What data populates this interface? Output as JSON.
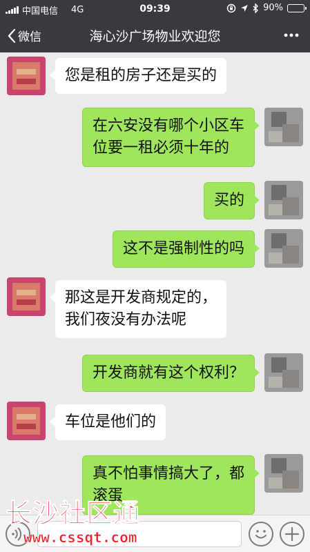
{
  "status_bar": {
    "carrier": "中国电信",
    "network": "4G",
    "time": "09:39",
    "battery_text": "90%",
    "battery_level": 0.9
  },
  "nav": {
    "back_label": "微信",
    "title": "海心沙广场物业欢迎您",
    "more_icon": "more-dots-icon"
  },
  "colors": {
    "bar": "#393a3f",
    "chat_bg": "#ebebeb",
    "bubble_out": "#9fe65c",
    "bubble_in": "#ffffff",
    "watermark": "#f41d2c"
  },
  "messages": [
    {
      "side": "in",
      "lines": [
        "您是租的房子还是买的"
      ]
    },
    {
      "side": "out",
      "lines": [
        "在六安没有哪个小区车",
        "位要一租必须十年的"
      ]
    },
    {
      "side": "out",
      "lines": [
        "买的"
      ]
    },
    {
      "side": "out",
      "lines": [
        "这不是强制性的吗"
      ]
    },
    {
      "side": "in",
      "lines": [
        "那这是开发商规定的，",
        "我们夜没有办法呢"
      ]
    },
    {
      "side": "out",
      "lines": [
        "开发商就有这个权利？"
      ]
    },
    {
      "side": "in",
      "lines": [
        "车位是他们的"
      ]
    },
    {
      "side": "out",
      "lines": [
        "真不怕事情搞大了，都",
        "滚蛋"
      ]
    }
  ],
  "input_bar": {
    "voice_icon": "voice-icon",
    "emoji_icon": "emoji-icon",
    "plus_icon": "plus-icon"
  },
  "watermark": {
    "title": "长沙社区通",
    "url": "www.cssqt.com"
  }
}
